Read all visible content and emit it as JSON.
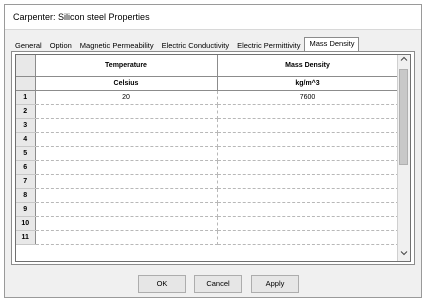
{
  "window": {
    "title": "Carpenter: Silicon steel Properties"
  },
  "tabs": [
    {
      "label": "General"
    },
    {
      "label": "Option"
    },
    {
      "label": "Magnetic Permeability"
    },
    {
      "label": "Electric Conductivity"
    },
    {
      "label": "Electric Permittivity"
    },
    {
      "label": "Mass Density",
      "active": true
    }
  ],
  "table": {
    "columns": [
      {
        "header": "Temperature",
        "unit": "Celsius"
      },
      {
        "header": "Mass Density",
        "unit": "kg/m^3"
      }
    ],
    "rows": [
      {
        "num": "1",
        "c1": "20",
        "c2": "7600"
      },
      {
        "num": "2",
        "c1": "",
        "c2": ""
      },
      {
        "num": "3",
        "c1": "",
        "c2": ""
      },
      {
        "num": "4",
        "c1": "",
        "c2": ""
      },
      {
        "num": "5",
        "c1": "",
        "c2": ""
      },
      {
        "num": "6",
        "c1": "",
        "c2": ""
      },
      {
        "num": "7",
        "c1": "",
        "c2": ""
      },
      {
        "num": "8",
        "c1": "",
        "c2": ""
      },
      {
        "num": "9",
        "c1": "",
        "c2": ""
      },
      {
        "num": "10",
        "c1": "",
        "c2": ""
      },
      {
        "num": "11",
        "c1": "",
        "c2": ""
      }
    ]
  },
  "icons": {
    "scroll_up": "chevron-up-icon",
    "scroll_down": "chevron-down-icon"
  },
  "buttons": {
    "ok": "OK",
    "cancel": "Cancel",
    "apply": "Apply"
  }
}
